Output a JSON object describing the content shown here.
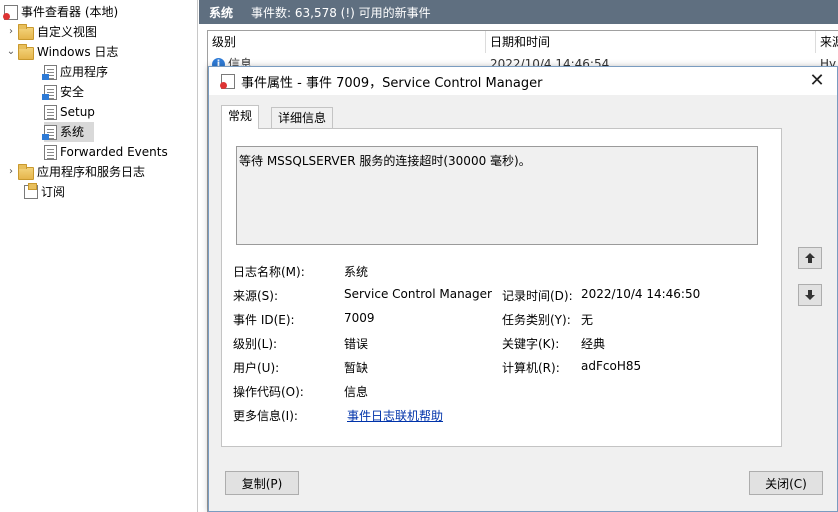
{
  "tree": {
    "root": "事件查看器 (本地)",
    "custom_views": "自定义视图",
    "windows_logs": "Windows 日志",
    "logs": [
      "应用程序",
      "安全",
      "Setup",
      "系统",
      "Forwarded Events"
    ],
    "app_service_logs": "应用程序和服务日志",
    "subscriptions": "订阅"
  },
  "main": {
    "header_name": "系统",
    "header_info": "事件数: 63,578 (!) 可用的新事件",
    "columns": [
      "级别",
      "日期和时间",
      "来源"
    ],
    "row": {
      "level": "信息",
      "datetime": "2022/10/4 14:46:54",
      "source": "Hy"
    }
  },
  "dialog": {
    "title": "事件属性 - 事件 7009，Service Control Manager",
    "tabs": [
      "常规",
      "详细信息"
    ],
    "description": "等待 MSSQLSERVER 服务的连接超时(30000 毫秒)。",
    "fields": {
      "log_name_label": "日志名称(M):",
      "log_name_value": "系统",
      "source_label": "来源(S):",
      "source_value": "Service Control Manager",
      "logged_label": "记录时间(D):",
      "logged_value": "2022/10/4 14:46:50",
      "event_id_label": "事件 ID(E):",
      "event_id_value": "7009",
      "task_label": "任务类别(Y):",
      "task_value": "无",
      "level_label": "级别(L):",
      "level_value": "错误",
      "keywords_label": "关键字(K):",
      "keywords_value": "经典",
      "user_label": "用户(U):",
      "user_value": "暂缺",
      "computer_label": "计算机(R):",
      "computer_value": "adFcoH85",
      "opcode_label": "操作代码(O):",
      "opcode_value": "信息",
      "more_info_label": "更多信息(I):",
      "more_info_link": "事件日志联机帮助"
    },
    "buttons": {
      "copy": "复制(P)",
      "close": "关闭(C)"
    }
  }
}
